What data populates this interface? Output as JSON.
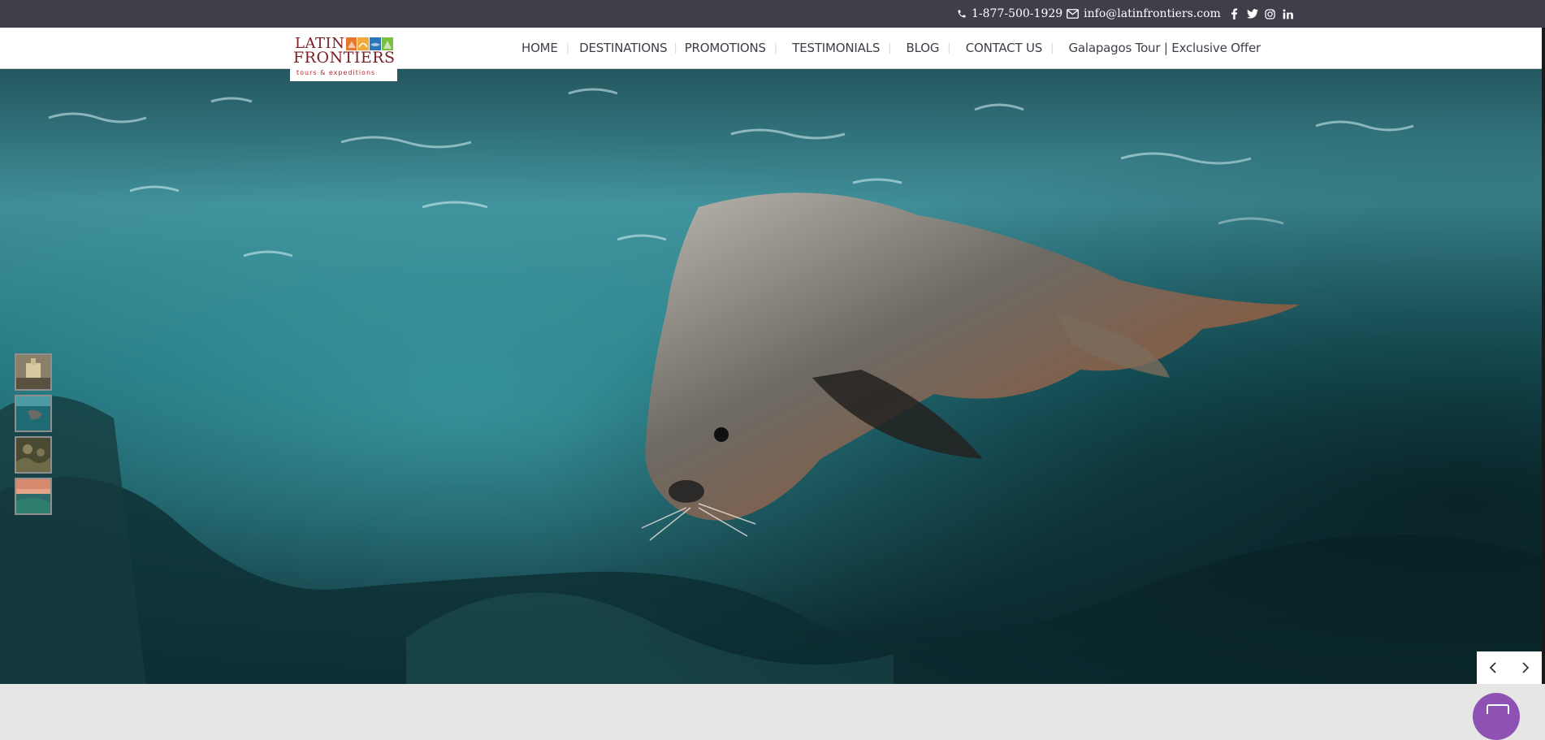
{
  "topbar": {
    "phone": "1-877-500-1929",
    "email": "info@latinfrontiers.com",
    "icons": [
      "phone-icon",
      "envelope-icon",
      "facebook-icon",
      "twitter-icon",
      "instagram-icon",
      "linkedin-icon"
    ]
  },
  "logo": {
    "line1": "LATIN",
    "line2": "FRONTIERS",
    "tagline": "tours & expeditions"
  },
  "nav": {
    "items": [
      {
        "label": "HOME"
      },
      {
        "label": "DESTINATIONS"
      },
      {
        "label": "PROMOTIONS"
      },
      {
        "label": "TESTIMONIALS"
      },
      {
        "label": "BLOG"
      },
      {
        "label": "CONTACT US"
      },
      {
        "label": "Galapagos Tour | Exclusive Offer"
      }
    ],
    "separator": "|"
  },
  "slider": {
    "thumbnail_count": 4,
    "active_thumbnail": 2,
    "prev_icon": "chevron-left-icon",
    "next_icon": "chevron-right-icon"
  },
  "colors": {
    "topbar_bg": "#3f3f49",
    "nav_text": "#3f3f49",
    "logo_red": "#7a1f24",
    "water_teal": "#1f6f78",
    "chat_purple": "#8d52b3"
  }
}
